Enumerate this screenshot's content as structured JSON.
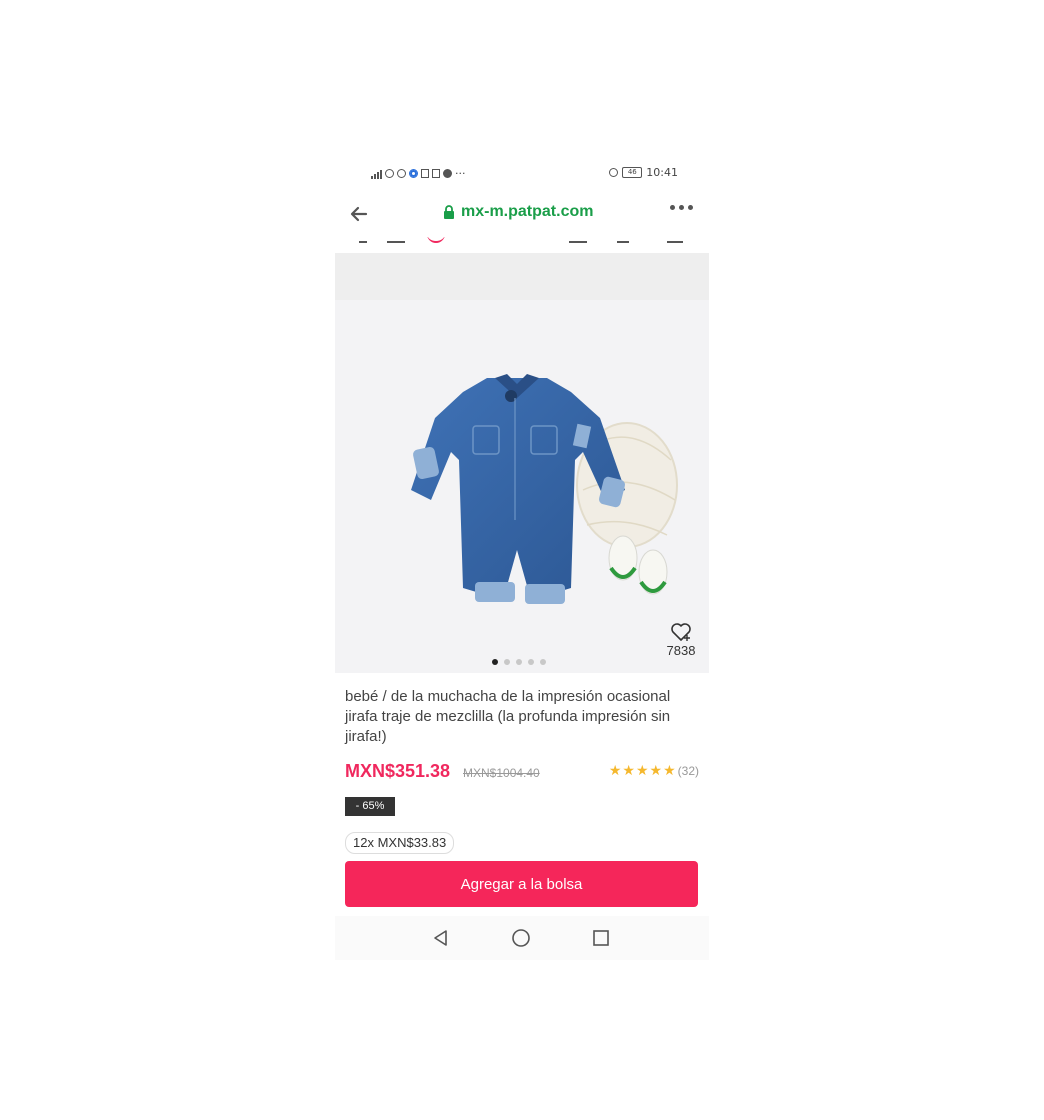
{
  "status_bar": {
    "battery": "46",
    "time": "10:41",
    "more_notifications": "···"
  },
  "browser": {
    "url": "mx-m.patpat.com"
  },
  "product": {
    "wishlist_count": "7838",
    "image_count": 5,
    "active_image_index": 0,
    "title": "bebé / de la muchacha de la impresión ocasional jirafa traje de mezclilla (la profunda impresión sin jirafa!)",
    "price": "MXN$351.38",
    "original_price": "MXN$1004.40",
    "rating": 5,
    "review_count": "(32)",
    "discount": "- 65%",
    "installment": "12x MXN$33.83",
    "add_to_bag_label": "Agregar a la bolsa"
  },
  "colors": {
    "accent_price": "#f0285e",
    "button": "#f5265a",
    "url_green": "#1a9e49",
    "star": "#f5b82e"
  }
}
